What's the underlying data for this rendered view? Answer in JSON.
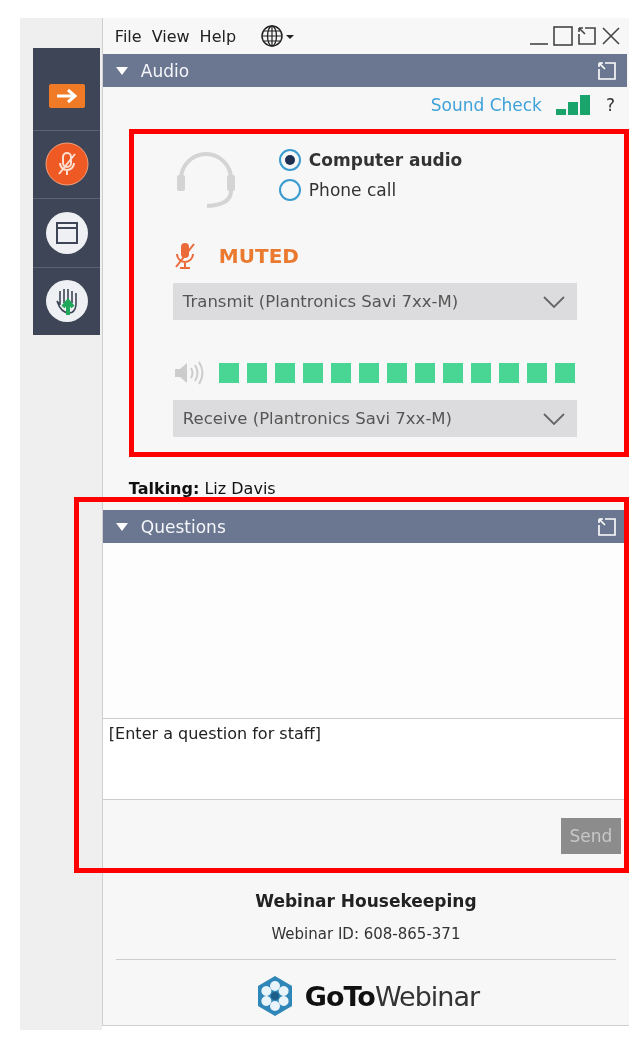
{
  "menu": [
    {
      "label": "File"
    },
    {
      "label": "View"
    },
    {
      "label": "Help"
    }
  ],
  "audio": {
    "title": "Audio",
    "expanded": true,
    "sound_check": "Sound Check",
    "help": "?",
    "modes": [
      {
        "label": "Computer audio",
        "selected": true
      },
      {
        "label": "Phone call",
        "selected": false
      }
    ],
    "muted": true,
    "mute_label": "MUTED",
    "transmit": {
      "value": "Transmit (Plantronics Savi 7xx-M)"
    },
    "receive": {
      "value": "Receive (Plantronics Savi 7xx-M)"
    }
  },
  "talking": "**Talking:** Liz Davis",
  "questions": {
    "title": "Questions",
    "expanded": true,
    "placeholder": "[Enter a question for staff]",
    "send": {
      "label": "Send",
      "disabled": true
    }
  },
  "footer": {
    "title": "Webinar Housekeeping",
    "webinar_id": "Webinar ID: 608-865-371",
    "brand": "**GoTo**Webinar"
  }
}
